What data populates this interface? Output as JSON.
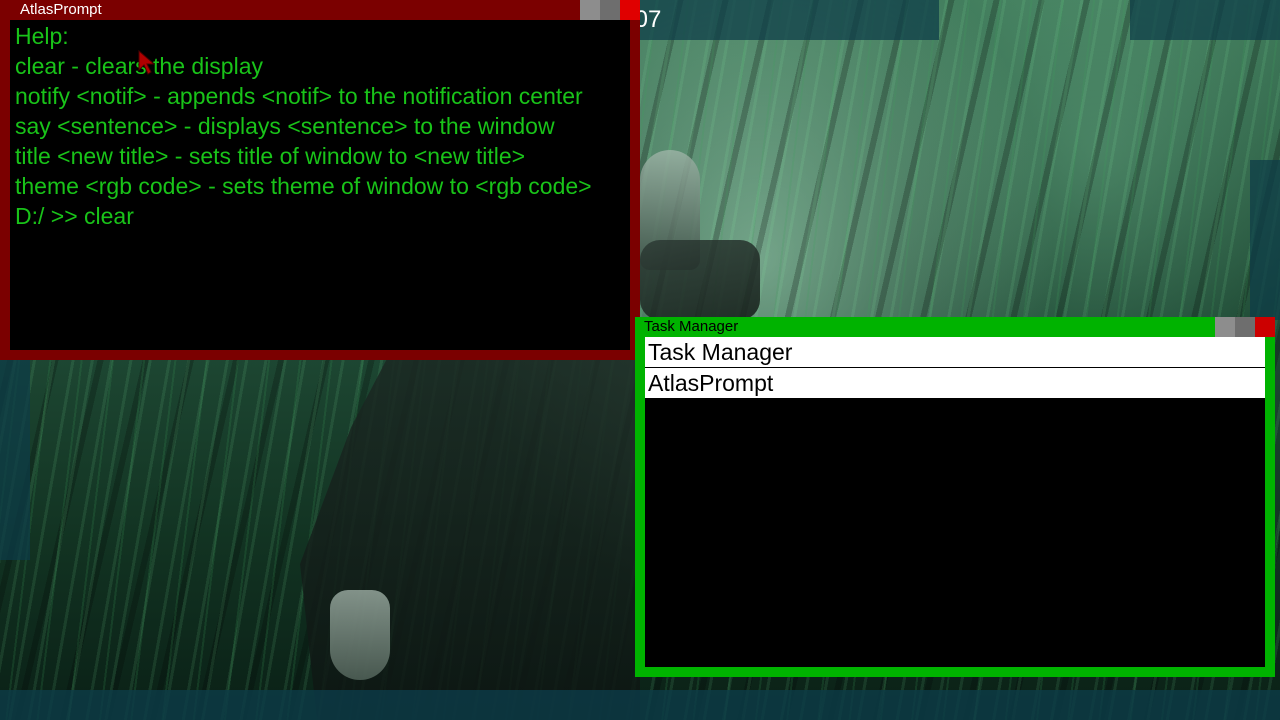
{
  "desktop": {
    "clock_text": ":07"
  },
  "prompt_window": {
    "title": "AtlasPrompt",
    "lines": [
      "Help:",
      "clear - clears the display",
      "notify <notif> - appends <notif> to the notification center",
      "say <sentence> - displays <sentence> to the window",
      "title <new title> - sets title of window to <new title>",
      "theme <rgb code> - sets theme of window to <rgb code>",
      "D:/ >> clear"
    ],
    "colors": {
      "frame": "#7b0000",
      "text": "#19c319",
      "close": "#e00000"
    }
  },
  "task_manager": {
    "title": "Task Manager",
    "tasks": [
      "Task Manager",
      "AtlasPrompt"
    ],
    "colors": {
      "frame": "#00b300",
      "close": "#cc0000"
    }
  }
}
